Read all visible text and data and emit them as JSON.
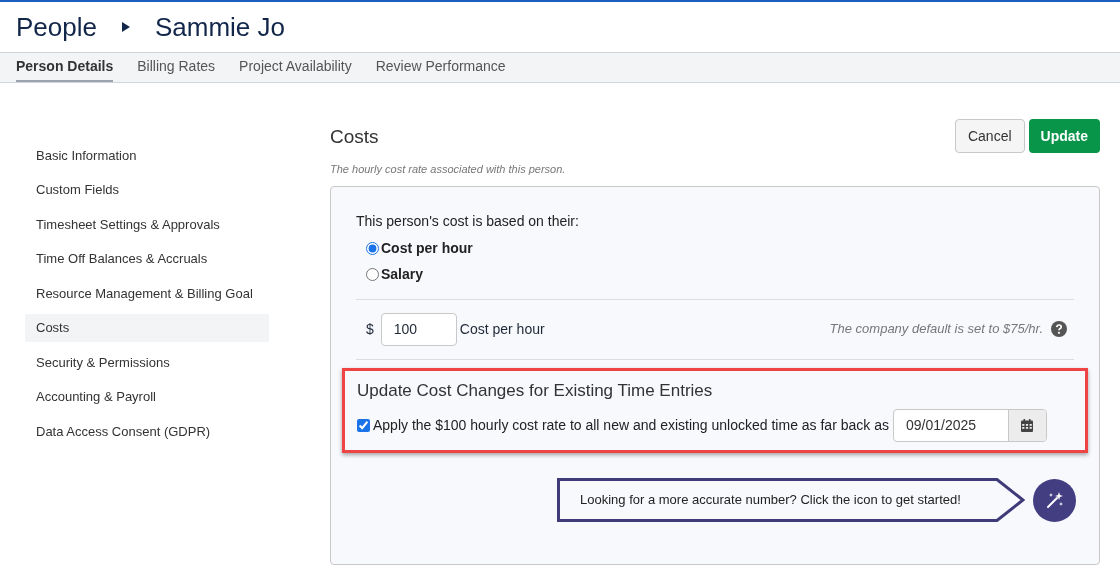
{
  "breadcrumb": {
    "parent": "People",
    "current": "Sammie Jo"
  },
  "tabs": [
    {
      "label": "Person Details",
      "selected": true
    },
    {
      "label": "Billing Rates",
      "selected": false
    },
    {
      "label": "Project Availability",
      "selected": false
    },
    {
      "label": "Review Performance",
      "selected": false
    }
  ],
  "sidebar": {
    "items": [
      {
        "label": "Basic Information",
        "selected": false
      },
      {
        "label": "Custom Fields",
        "selected": false
      },
      {
        "label": "Timesheet Settings & Approvals",
        "selected": false
      },
      {
        "label": "Time Off Balances & Accruals",
        "selected": false
      },
      {
        "label": "Resource Management & Billing Goal",
        "selected": false
      },
      {
        "label": "Costs",
        "selected": true
      },
      {
        "label": "Security & Permissions",
        "selected": false
      },
      {
        "label": "Accounting & Payroll",
        "selected": false
      },
      {
        "label": "Data Access Consent (GDPR)",
        "selected": false
      }
    ]
  },
  "section": {
    "title": "Costs",
    "subtitle": "The hourly cost rate associated with this person.",
    "buttons": [
      {
        "label": "Cancel",
        "kind": "secondary"
      },
      {
        "label": "Update",
        "kind": "primary"
      }
    ]
  },
  "basis": {
    "prompt": "This person's cost is based on their:",
    "options": [
      {
        "label": "Cost per hour",
        "selected": true
      },
      {
        "label": "Salary",
        "selected": false
      }
    ]
  },
  "rate": {
    "currency": "$",
    "value": "100",
    "unit": "Cost per hour",
    "note": "The company default is set to $75/hr."
  },
  "update_changes": {
    "title": "Update Cost Changes for Existing Time Entries",
    "checkbox_label": "Apply the $100 hourly cost rate to all new and existing unlocked time as far back as",
    "checked": true,
    "date": "09/01/2025"
  },
  "hint": {
    "text": "Looking for a more accurate number? Click the icon to get started!"
  }
}
